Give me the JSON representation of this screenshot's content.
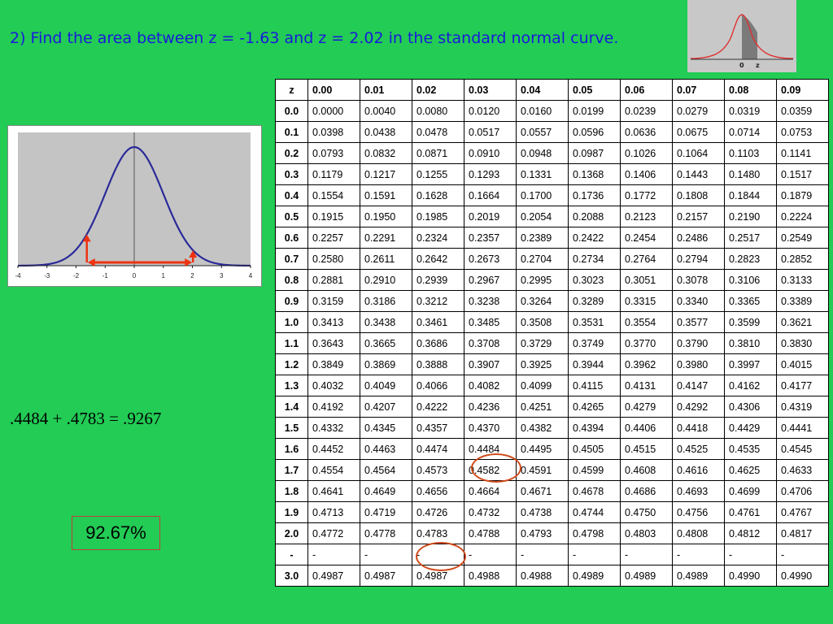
{
  "title": "2)  Find the area between z = -1.63 and z = 2.02 in the standard normal curve.",
  "thumbnail": {
    "label_zero": "0",
    "label_z": "z"
  },
  "graph": {
    "ticks": [
      "-4",
      "-3",
      "-2",
      "-1",
      "0",
      "1",
      "2",
      "3",
      "4"
    ]
  },
  "equation": ".4484 + .4783 = .9267",
  "answer": "92.67%",
  "table": {
    "headers": [
      "z",
      "0.00",
      "0.01",
      "0.02",
      "0.03",
      "0.04",
      "0.05",
      "0.06",
      "0.07",
      "0.08",
      "0.09"
    ],
    "rows": [
      {
        "z": "0.0",
        "values": [
          "0.0000",
          "0.0040",
          "0.0080",
          "0.0120",
          "0.0160",
          "0.0199",
          "0.0239",
          "0.0279",
          "0.0319",
          "0.0359"
        ]
      },
      {
        "z": "0.1",
        "values": [
          "0.0398",
          "0.0438",
          "0.0478",
          "0.0517",
          "0.0557",
          "0.0596",
          "0.0636",
          "0.0675",
          "0.0714",
          "0.0753"
        ]
      },
      {
        "z": "0.2",
        "values": [
          "0.0793",
          "0.0832",
          "0.0871",
          "0.0910",
          "0.0948",
          "0.0987",
          "0.1026",
          "0.1064",
          "0.1103",
          "0.1141"
        ]
      },
      {
        "z": "0.3",
        "values": [
          "0.1179",
          "0.1217",
          "0.1255",
          "0.1293",
          "0.1331",
          "0.1368",
          "0.1406",
          "0.1443",
          "0.1480",
          "0.1517"
        ]
      },
      {
        "z": "0.4",
        "values": [
          "0.1554",
          "0.1591",
          "0.1628",
          "0.1664",
          "0.1700",
          "0.1736",
          "0.1772",
          "0.1808",
          "0.1844",
          "0.1879"
        ]
      },
      {
        "z": "0.5",
        "values": [
          "0.1915",
          "0.1950",
          "0.1985",
          "0.2019",
          "0.2054",
          "0.2088",
          "0.2123",
          "0.2157",
          "0.2190",
          "0.2224"
        ]
      },
      {
        "z": "0.6",
        "values": [
          "0.2257",
          "0.2291",
          "0.2324",
          "0.2357",
          "0.2389",
          "0.2422",
          "0.2454",
          "0.2486",
          "0.2517",
          "0.2549"
        ]
      },
      {
        "z": "0.7",
        "values": [
          "0.2580",
          "0.2611",
          "0.2642",
          "0.2673",
          "0.2704",
          "0.2734",
          "0.2764",
          "0.2794",
          "0.2823",
          "0.2852"
        ]
      },
      {
        "z": "0.8",
        "values": [
          "0.2881",
          "0.2910",
          "0.2939",
          "0.2967",
          "0.2995",
          "0.3023",
          "0.3051",
          "0.3078",
          "0.3106",
          "0.3133"
        ]
      },
      {
        "z": "0.9",
        "values": [
          "0.3159",
          "0.3186",
          "0.3212",
          "0.3238",
          "0.3264",
          "0.3289",
          "0.3315",
          "0.3340",
          "0.3365",
          "0.3389"
        ]
      },
      {
        "z": "1.0",
        "values": [
          "0.3413",
          "0.3438",
          "0.3461",
          "0.3485",
          "0.3508",
          "0.3531",
          "0.3554",
          "0.3577",
          "0.3599",
          "0.3621"
        ]
      },
      {
        "z": "1.1",
        "values": [
          "0.3643",
          "0.3665",
          "0.3686",
          "0.3708",
          "0.3729",
          "0.3749",
          "0.3770",
          "0.3790",
          "0.3810",
          "0.3830"
        ]
      },
      {
        "z": "1.2",
        "values": [
          "0.3849",
          "0.3869",
          "0.3888",
          "0.3907",
          "0.3925",
          "0.3944",
          "0.3962",
          "0.3980",
          "0.3997",
          "0.4015"
        ]
      },
      {
        "z": "1.3",
        "values": [
          "0.4032",
          "0.4049",
          "0.4066",
          "0.4082",
          "0.4099",
          "0.4115",
          "0.4131",
          "0.4147",
          "0.4162",
          "0.4177"
        ]
      },
      {
        "z": "1.4",
        "values": [
          "0.4192",
          "0.4207",
          "0.4222",
          "0.4236",
          "0.4251",
          "0.4265",
          "0.4279",
          "0.4292",
          "0.4306",
          "0.4319"
        ]
      },
      {
        "z": "1.5",
        "values": [
          "0.4332",
          "0.4345",
          "0.4357",
          "0.4370",
          "0.4382",
          "0.4394",
          "0.4406",
          "0.4418",
          "0.4429",
          "0.4441"
        ]
      },
      {
        "z": "1.6",
        "values": [
          "0.4452",
          "0.4463",
          "0.4474",
          "0.4484",
          "0.4495",
          "0.4505",
          "0.4515",
          "0.4525",
          "0.4535",
          "0.4545"
        ]
      },
      {
        "z": "1.7",
        "values": [
          "0.4554",
          "0.4564",
          "0.4573",
          "0.4582",
          "0.4591",
          "0.4599",
          "0.4608",
          "0.4616",
          "0.4625",
          "0.4633"
        ]
      },
      {
        "z": "1.8",
        "values": [
          "0.4641",
          "0.4649",
          "0.4656",
          "0.4664",
          "0.4671",
          "0.4678",
          "0.4686",
          "0.4693",
          "0.4699",
          "0.4706"
        ]
      },
      {
        "z": "1.9",
        "values": [
          "0.4713",
          "0.4719",
          "0.4726",
          "0.4732",
          "0.4738",
          "0.4744",
          "0.4750",
          "0.4756",
          "0.4761",
          "0.4767"
        ]
      },
      {
        "z": "2.0",
        "values": [
          "0.4772",
          "0.4778",
          "0.4783",
          "0.4788",
          "0.4793",
          "0.4798",
          "0.4803",
          "0.4808",
          "0.4812",
          "0.4817"
        ]
      },
      {
        "z": "-",
        "values": [
          "-",
          "-",
          "-",
          "-",
          "-",
          "-",
          "-",
          "-",
          "-",
          "-"
        ]
      },
      {
        "z": "3.0",
        "values": [
          "0.4987",
          "0.4987",
          "0.4987",
          "0.4988",
          "0.4988",
          "0.4989",
          "0.4989",
          "0.4989",
          "0.4990",
          "0.4990"
        ]
      }
    ]
  },
  "highlight_color": "#d04a1a",
  "curve_color": "#2a2a9a",
  "arrow_color": "#ee3311"
}
